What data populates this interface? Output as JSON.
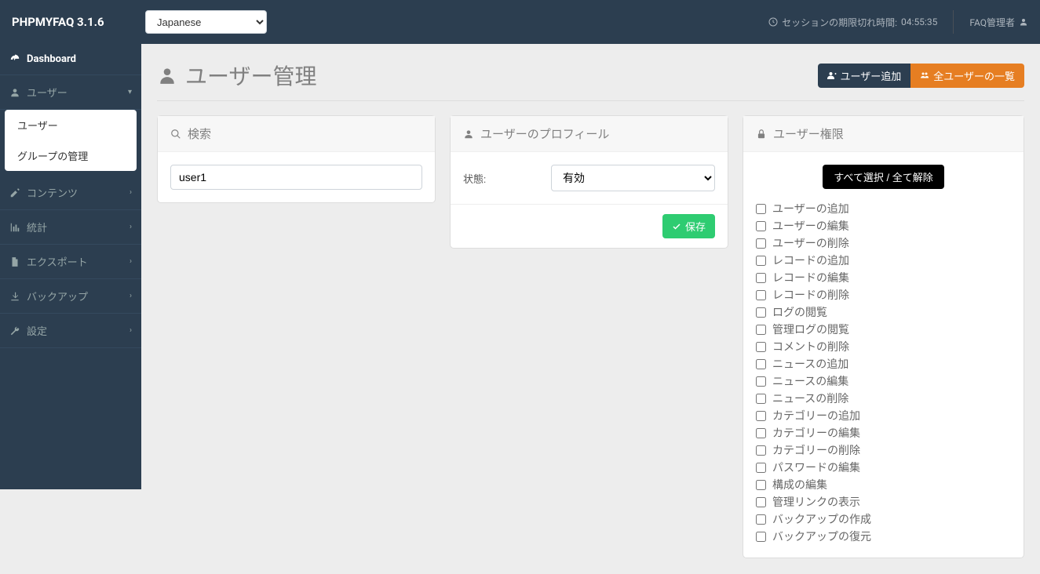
{
  "brand": "PHPMYFAQ 3.1.6",
  "language": "Japanese",
  "session": {
    "label": "セッションの期限切れ時間:",
    "time": "04:55:35"
  },
  "admin_link": "FAQ管理者",
  "sidebar": {
    "dashboard": "Dashboard",
    "items": [
      {
        "label": "ユーザー",
        "expanded": true
      },
      {
        "label": "コンテンツ"
      },
      {
        "label": "統計"
      },
      {
        "label": "エクスポート"
      },
      {
        "label": "バックアップ"
      },
      {
        "label": "設定"
      }
    ],
    "user_sub": [
      {
        "label": "ユーザー"
      },
      {
        "label": "グループの管理"
      }
    ]
  },
  "page": {
    "title": "ユーザー管理",
    "add_user": "ユーザー追加",
    "all_users": "全ユーザーの一覧"
  },
  "search": {
    "title": "検索",
    "value": "user1"
  },
  "profile": {
    "title": "ユーザーのプロフィール",
    "status_label": "状態:",
    "status_value": "有効",
    "save": "保存"
  },
  "rights": {
    "title": "ユーザー権限",
    "toggle_all": "すべて選択 / 全て解除",
    "items": [
      "ユーザーの追加",
      "ユーザーの編集",
      "ユーザーの削除",
      "レコードの追加",
      "レコードの編集",
      "レコードの削除",
      "ログの閲覧",
      "管理ログの閲覧",
      "コメントの削除",
      "ニュースの追加",
      "ニュースの編集",
      "ニュースの削除",
      "カテゴリーの追加",
      "カテゴリーの編集",
      "カテゴリーの削除",
      "パスワードの編集",
      "構成の編集",
      "管理リンクの表示",
      "バックアップの作成",
      "バックアップの復元"
    ]
  }
}
